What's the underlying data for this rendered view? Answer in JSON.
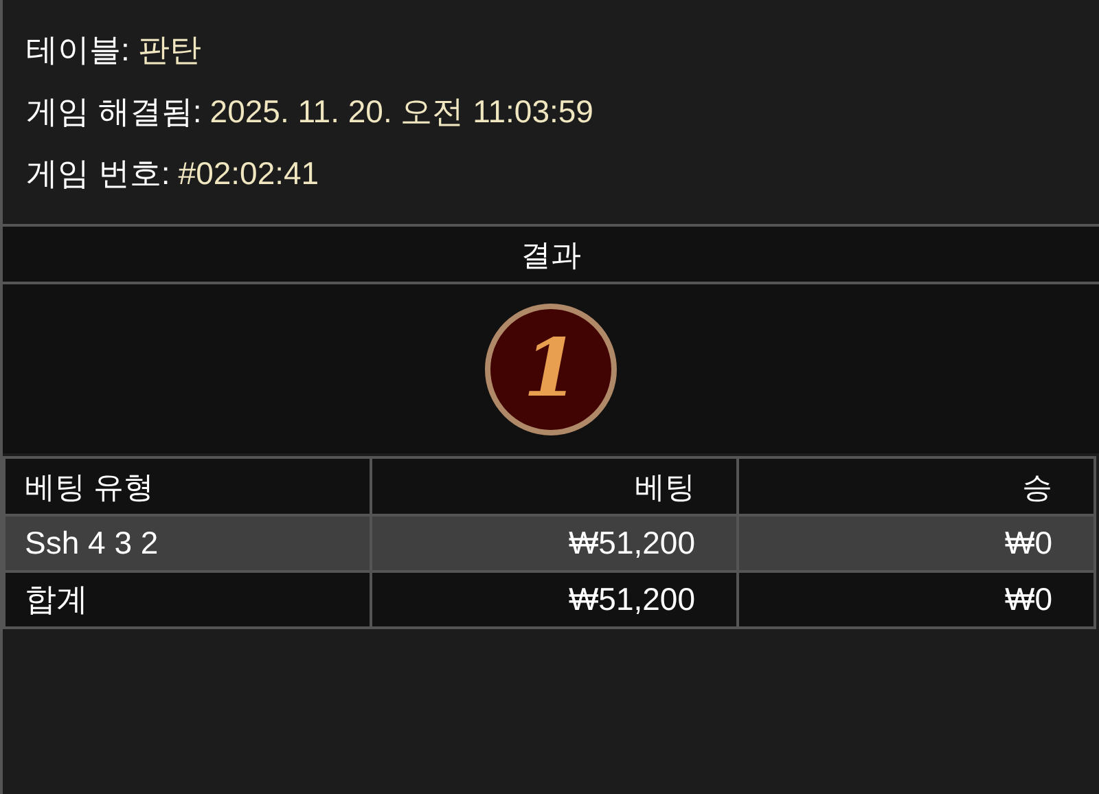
{
  "info": [
    {
      "label": "테이블:",
      "value": "판탄"
    },
    {
      "label": "게임 해결됨:",
      "value": "2025. 11. 20. 오전 11:03:59"
    },
    {
      "label": "게임 번호:",
      "value": "#02:02:41"
    }
  ],
  "result": {
    "title": "결과",
    "number": "1"
  },
  "table": {
    "columns": [
      "베팅 유형",
      "베팅",
      "승"
    ],
    "rows": [
      {
        "kind": "bet",
        "cells": [
          "Ssh 4 3 2",
          "₩51,200",
          "₩0"
        ]
      },
      {
        "kind": "total",
        "cells": [
          "합계",
          "₩51,200",
          "₩0"
        ]
      }
    ]
  }
}
